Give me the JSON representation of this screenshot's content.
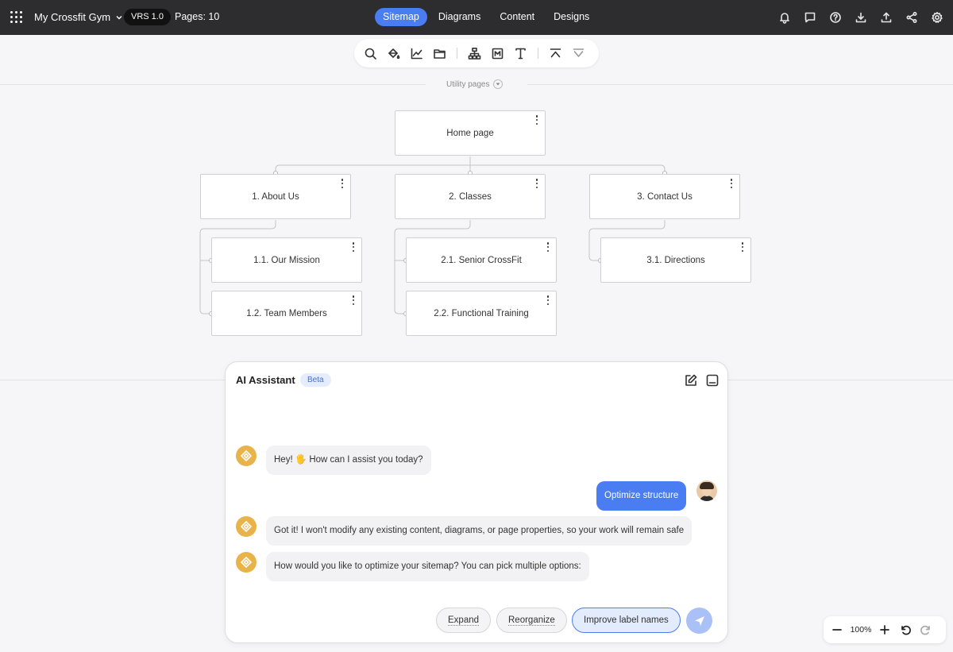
{
  "header": {
    "project_name": "My Crossfit Gym",
    "version": "VRS 1.0",
    "pages_label": "Pages: 10",
    "tabs": [
      {
        "label": "Sitemap",
        "active": true
      },
      {
        "label": "Diagrams",
        "active": false
      },
      {
        "label": "Content",
        "active": false
      },
      {
        "label": "Designs",
        "active": false
      }
    ],
    "icons": [
      "bell-icon",
      "comment-icon",
      "help-icon",
      "download-icon",
      "upload-icon",
      "share-icon",
      "gear-icon"
    ]
  },
  "toolbar": {
    "tools": [
      "search-icon",
      "paint-bucket-icon",
      "chart-icon",
      "folder-icon",
      "sitemap-icon",
      "markdown-icon",
      "text-icon",
      "collapse-up-icon",
      "expand-down-icon"
    ]
  },
  "utility_pages": "Utility pages",
  "sitemap": {
    "root": "Home page",
    "sections": [
      {
        "label": "1. About Us",
        "children": [
          "1.1. Our Mission",
          "1.2. Team Members"
        ]
      },
      {
        "label": "2. Classes",
        "children": [
          "2.1. Senior CrossFit",
          "2.2. Functional Training"
        ]
      },
      {
        "label": "3. Contact Us",
        "children": [
          "3.1. Directions"
        ]
      }
    ]
  },
  "assistant": {
    "title": "AI Assistant",
    "badge": "Beta",
    "messages": [
      {
        "from": "bot",
        "text": "Hey! 🖐️ How can I assist you today?"
      },
      {
        "from": "user",
        "text": "Optimize structure"
      },
      {
        "from": "bot",
        "text": "Got it! I won't modify any existing content, diagrams, or page properties, so your work will remain safe"
      },
      {
        "from": "bot",
        "text": "How would you like to optimize your sitemap? You can pick multiple options:"
      }
    ],
    "options": [
      "Expand",
      "Reorganize",
      "Improve label names"
    ],
    "selected_option": "Improve label names"
  },
  "zoom": {
    "level": "100%"
  },
  "colors": {
    "accent": "#4a7cf2",
    "topbar": "#2d2d2f",
    "bot_avatar": "#e8b44a"
  }
}
